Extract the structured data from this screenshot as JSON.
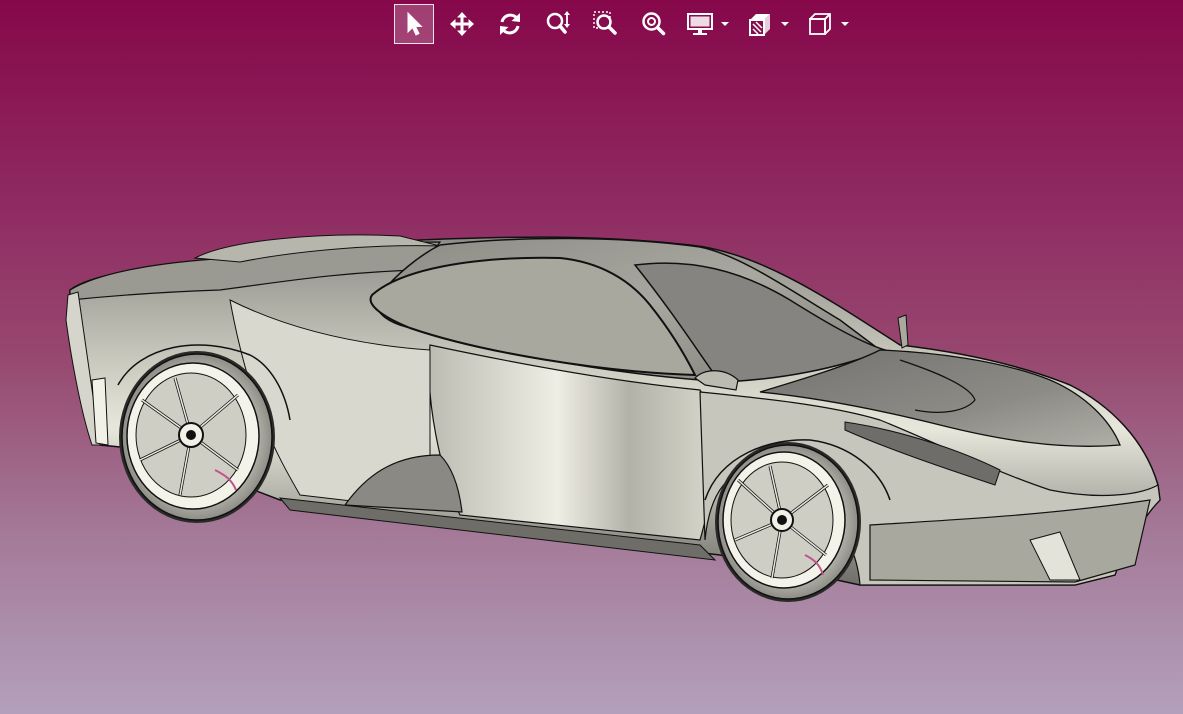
{
  "toolbar": {
    "buttons": [
      {
        "name": "select-tool-button",
        "icon": "cursor-arrow-icon",
        "active": true
      },
      {
        "name": "pan-tool-button",
        "icon": "move-arrows-icon",
        "active": false
      },
      {
        "name": "rotate-tool-button",
        "icon": "rotate-icon",
        "active": false
      },
      {
        "name": "zoom-dynamic-button",
        "icon": "zoom-updown-icon",
        "active": false
      },
      {
        "name": "zoom-window-button",
        "icon": "zoom-window-icon",
        "active": false
      },
      {
        "name": "zoom-fit-button",
        "icon": "zoom-fit-icon",
        "active": false
      },
      {
        "name": "display-mode-button",
        "icon": "monitor-icon",
        "has_dropdown": true
      },
      {
        "name": "section-view-button",
        "icon": "section-view-icon",
        "has_dropdown": true
      },
      {
        "name": "view-orientation-button",
        "icon": "view-cube-icon",
        "has_dropdown": true
      }
    ],
    "icon_color": "#ffffff",
    "active_highlight_color": "#ffffff"
  },
  "viewport": {
    "background_top": "#86084a",
    "background_bottom": "#b3a0bb",
    "model": "sports-car-3d-model",
    "model_color": "#a7a69c",
    "edge_color": "#0f0f0f"
  }
}
